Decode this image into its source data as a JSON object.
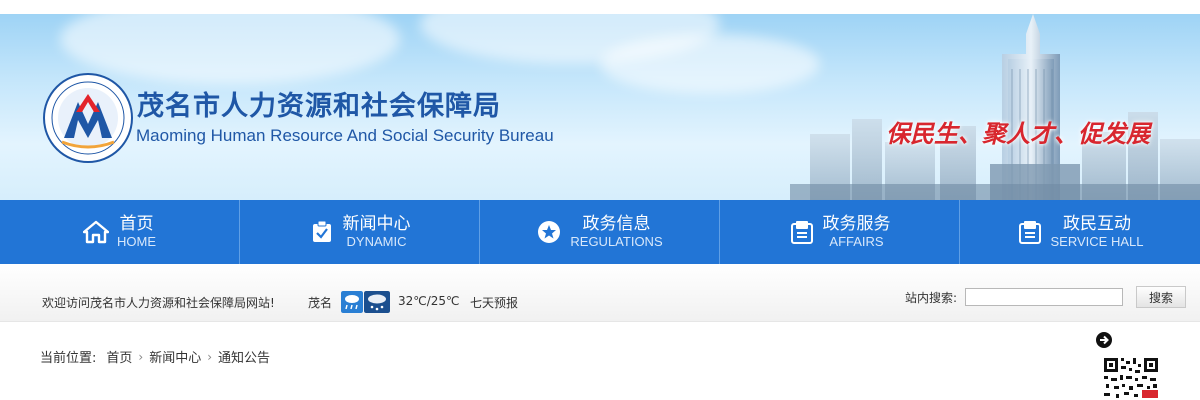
{
  "header": {
    "title_cn": "茂名市人力资源和社会保障局",
    "title_en": "Maoming Human Resource And Social Security Bureau",
    "slogan": "保民生、聚人才、促发展",
    "logo_icon": "bureau-emblem-icon"
  },
  "nav": {
    "items": [
      {
        "label_cn": "首页",
        "label_en": "HOME",
        "icon": "home-icon"
      },
      {
        "label_cn": "新闻中心",
        "label_en": "DYNAMIC",
        "icon": "clipboard-icon"
      },
      {
        "label_cn": "政务信息",
        "label_en": "REGULATIONS",
        "icon": "star-icon"
      },
      {
        "label_cn": "政务服务",
        "label_en": "AFFAIRS",
        "icon": "document-icon"
      },
      {
        "label_cn": "政民互动",
        "label_en": "SERVICE HALL",
        "icon": "document-icon"
      }
    ]
  },
  "infobar": {
    "welcome": "欢迎访问茂名市人力资源和社会保障局网站!",
    "city": "茂名",
    "temperature": "32℃/25℃",
    "forecast_link": "七天预报",
    "search_label": "站内搜索:",
    "search_value": "",
    "search_button": "搜索"
  },
  "breadcrumb": {
    "prefix": "当前位置:",
    "items": [
      "首页",
      "新闻中心",
      "通知公告"
    ]
  },
  "colors": {
    "nav_bg": "#2275d6",
    "title_blue": "#1f57a6",
    "slogan_red": "#d8262e"
  }
}
